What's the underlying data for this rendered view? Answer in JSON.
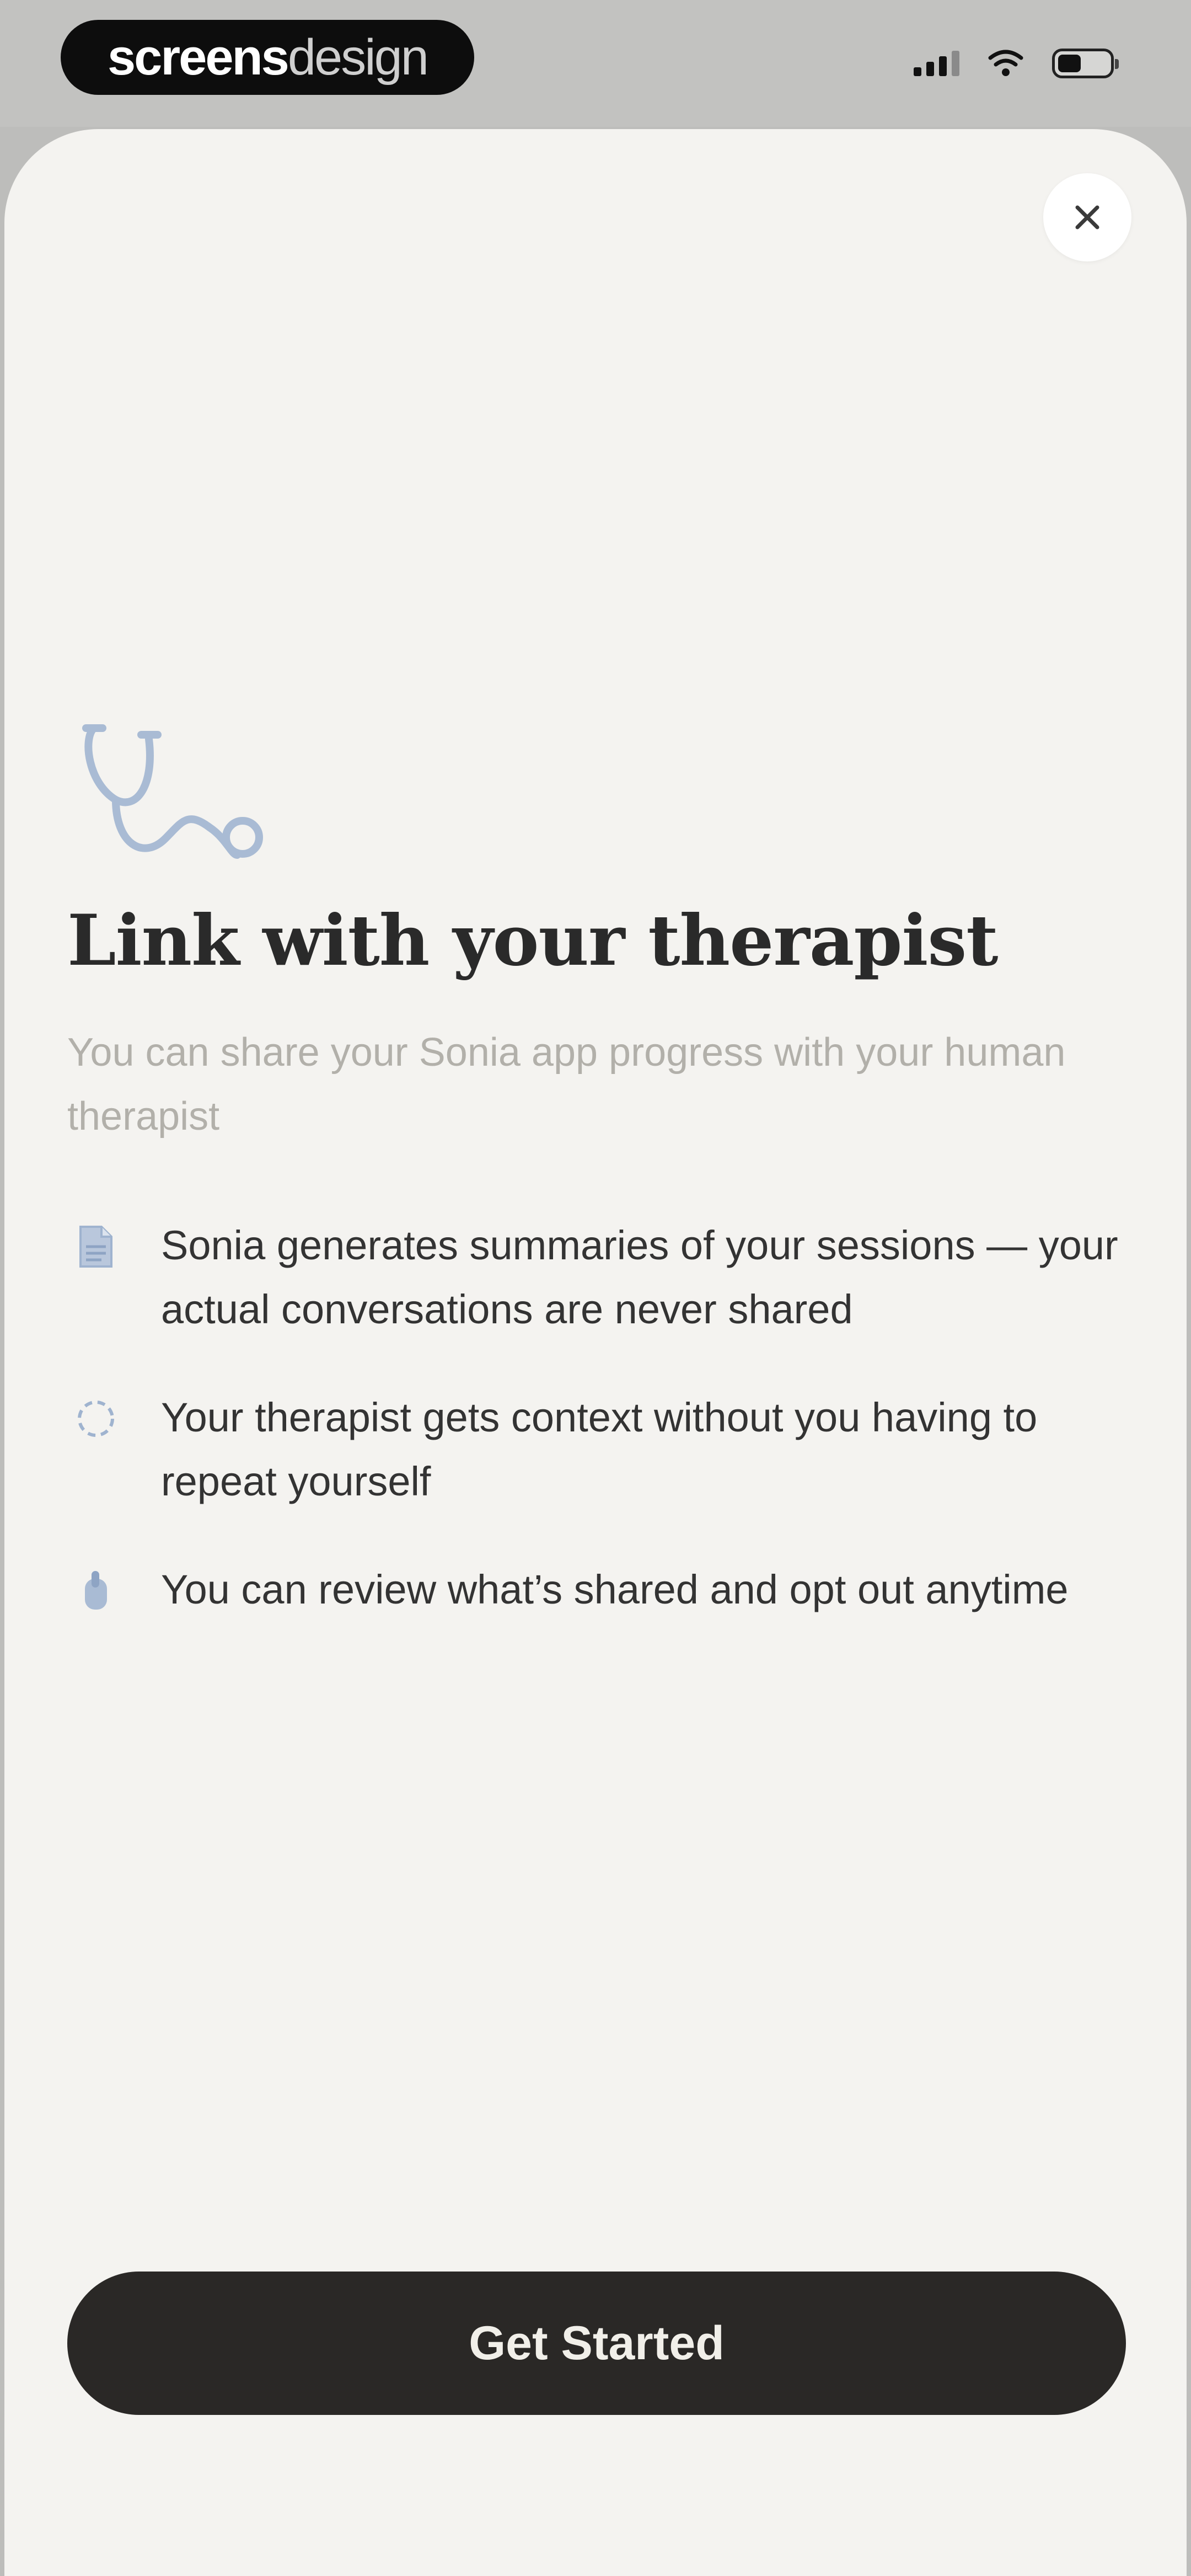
{
  "status_bar": {
    "brand_bold": "screens",
    "brand_light": "design"
  },
  "modal": {
    "close_label": "✕",
    "title": "Link with your therapist",
    "subtitle": "You can share your Sonia app progress with your human therapist",
    "features": [
      {
        "icon": "document-icon",
        "text": "Sonia generates summaries of your sessions — your actual conversations are never shared"
      },
      {
        "icon": "refresh-icon",
        "text": "Your therapist gets context without you having to repeat yourself"
      },
      {
        "icon": "hand-icon",
        "text": "You can review what’s shared and opt out anytime"
      }
    ],
    "cta_label": "Get Started"
  },
  "colors": {
    "accent_icon": "#9fb3cf",
    "button_bg": "#2a2826",
    "sheet_bg": "#f4f3f0"
  }
}
